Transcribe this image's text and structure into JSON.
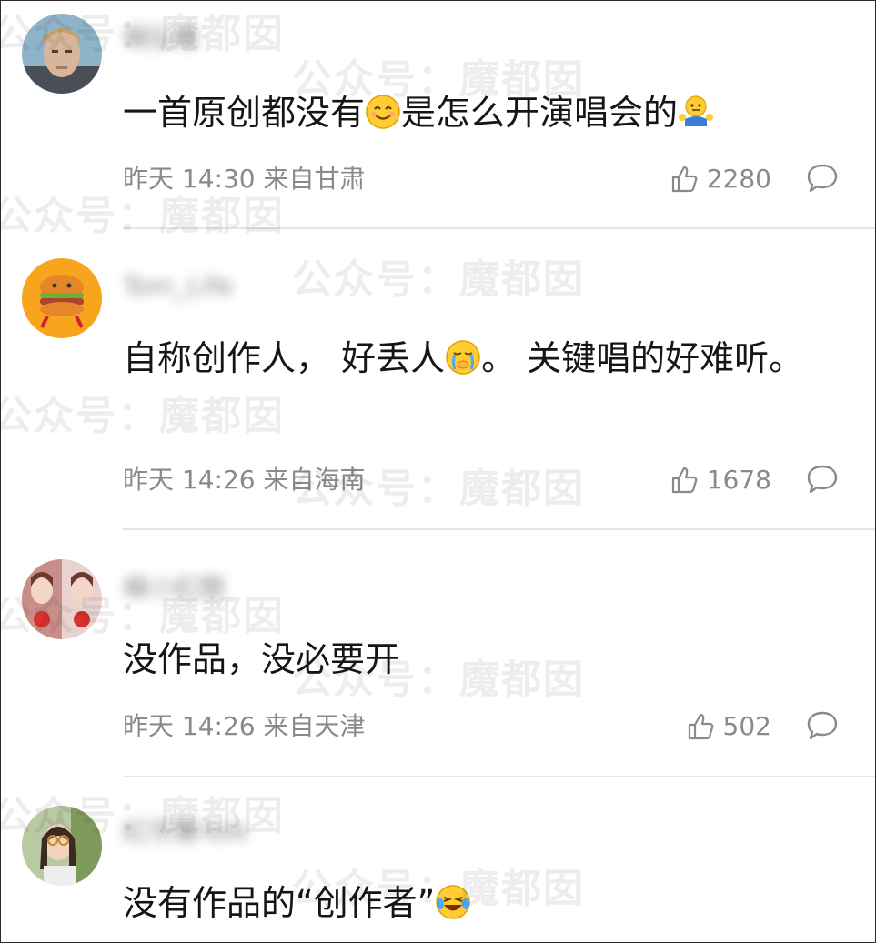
{
  "comments": [
    {
      "username": "楊弘雅",
      "text_parts": [
        "一首原创都没有",
        "是怎么开演唱会的"
      ],
      "emojis": [
        "smile-emoji",
        "shrug-emoji"
      ],
      "time": "昨天 14:30",
      "location": "来自甘肃",
      "likes": "2280"
    },
    {
      "username": "Tom_Life",
      "text_parts": [
        "自称创作人， 好丢人",
        "。 关键唱的好难听。"
      ],
      "emojis": [
        "crying-emoji"
      ],
      "time": "昨天 14:26",
      "location": "来自海南",
      "likes": "1678"
    },
    {
      "username": "楊小紅顏",
      "text_parts": [
        "没作品，没必要开"
      ],
      "time": "昨天 14:26",
      "location": "来自天津",
      "likes": "502"
    },
    {
      "username": "紅帘幕Yolk",
      "text_parts": [
        "没有作品的“创作者”"
      ],
      "emojis": [
        "laugh-cry-emoji"
      ]
    }
  ],
  "watermark": {
    "text": "公众号：魔都囡"
  },
  "colors": {
    "text": "#151515",
    "meta": "#8a8a8a",
    "divider": "#e6e6e6",
    "border": "#2a2a2a"
  }
}
